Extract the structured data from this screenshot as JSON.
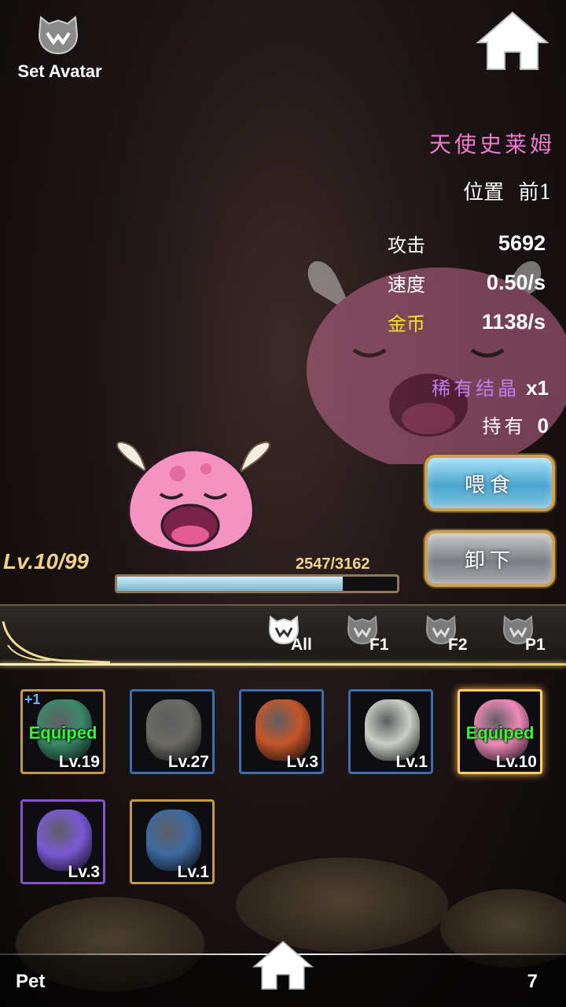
{
  "header": {
    "set_avatar_label": "Set Avatar"
  },
  "pet": {
    "name": "天使史莱姆",
    "position_label": "位置",
    "position_value": "前1",
    "stats": [
      {
        "label": "攻击",
        "value": "5692",
        "color": "#ffffff"
      },
      {
        "label": "速度",
        "value": "0.50/s",
        "color": "#ffffff"
      },
      {
        "label": "金币",
        "value": "1138/s",
        "color": "#f3e02a"
      }
    ],
    "rare_crystal_label": "稀有结晶",
    "rare_crystal_qty": "x1",
    "owned_label": "持有",
    "owned_qty": "0",
    "level": "Lv.10",
    "level_max": "/99",
    "xp_text": "2547/3162",
    "xp_fraction": 0.805
  },
  "actions": {
    "feed_label": "喂食",
    "unload_label": "卸下"
  },
  "filters": [
    {
      "label": "All",
      "active": true
    },
    {
      "label": "F1",
      "active": false
    },
    {
      "label": "F2",
      "active": false
    },
    {
      "label": "P1",
      "active": false
    }
  ],
  "pets_grid": [
    {
      "level": "Lv.19",
      "equipped": "Equiped",
      "plus": "+1",
      "frame": "gold",
      "icon": "gorgon-warrior-icon",
      "color": "#3b8a6a"
    },
    {
      "level": "Lv.27",
      "equipped": "",
      "plus": "",
      "frame": "blue",
      "icon": "clockwork-robot-icon",
      "color": "#6b6a63"
    },
    {
      "level": "Lv.3",
      "equipped": "",
      "plus": "",
      "frame": "blue",
      "icon": "fire-serpent-icon",
      "color": "#c4562a"
    },
    {
      "level": "Lv.1",
      "equipped": "",
      "plus": "",
      "frame": "blue",
      "icon": "sprout-ghost-icon",
      "color": "#c9cfc4"
    },
    {
      "level": "Lv.10",
      "equipped": "Equiped",
      "plus": "",
      "frame": "selected",
      "icon": "angel-slime-icon",
      "color": "#f089b8"
    },
    {
      "level": "Lv.3",
      "equipped": "",
      "plus": "",
      "frame": "purple",
      "icon": "purple-bat-slime-icon",
      "color": "#7a5ad6"
    },
    {
      "level": "Lv.1",
      "equipped": "",
      "plus": "",
      "frame": "gold",
      "icon": "blue-imp-icon",
      "color": "#3d6aa0"
    }
  ],
  "footer": {
    "title": "Pet",
    "count": "7"
  }
}
